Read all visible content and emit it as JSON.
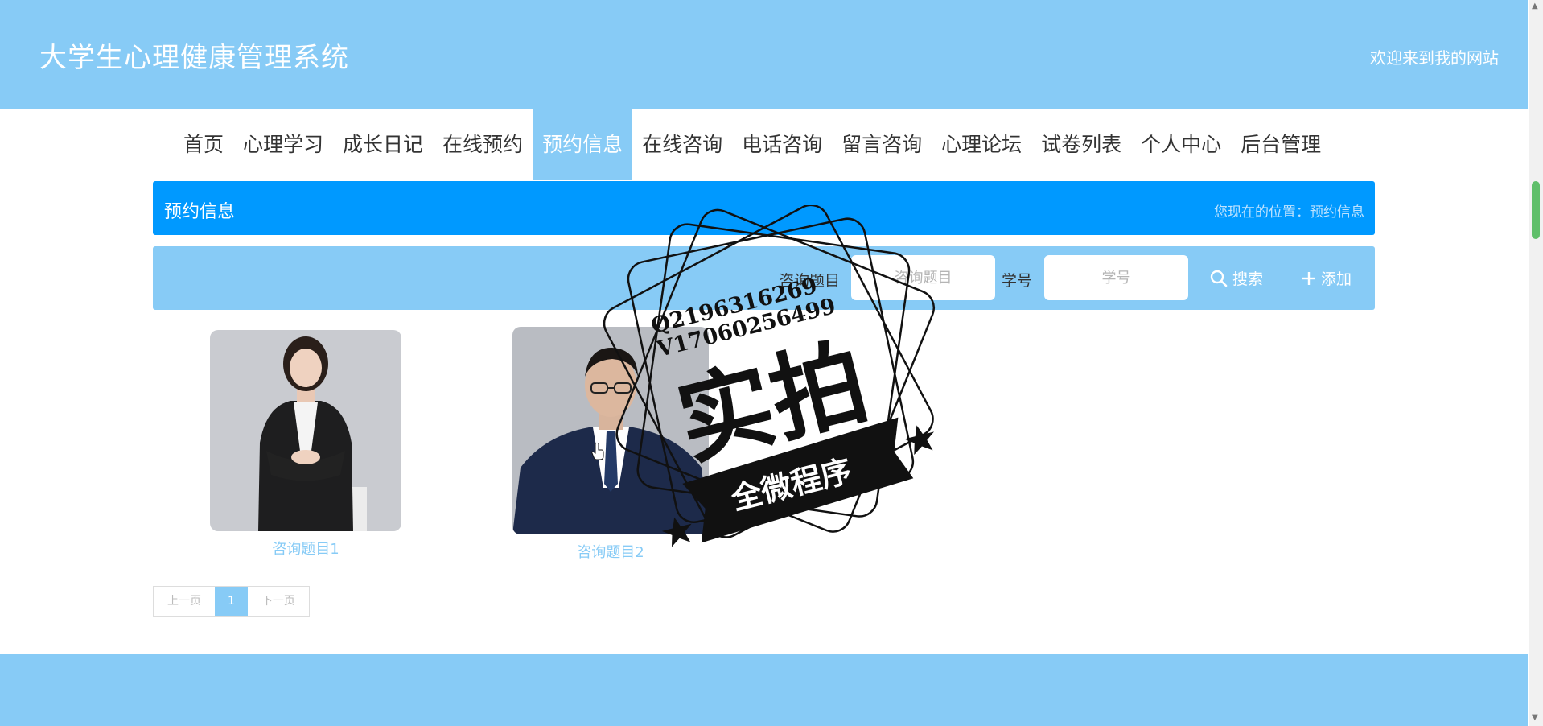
{
  "header": {
    "title": "大学生心理健康管理系统",
    "welcome": "欢迎来到我的网站"
  },
  "nav": {
    "items": [
      "首页",
      "心理学习",
      "成长日记",
      "在线预约",
      "预约信息",
      "在线咨询",
      "电话咨询",
      "留言咨询",
      "心理论坛",
      "试卷列表",
      "个人中心",
      "后台管理"
    ],
    "active": "预约信息"
  },
  "page": {
    "title": "预约信息",
    "breadcrumb": "您现在的位置：预约信息"
  },
  "search": {
    "topic_label": "咨询题目",
    "topic_placeholder": "咨询题目",
    "student_label": "学号",
    "student_placeholder": "学号",
    "search_button": "搜索",
    "add_button": "添加"
  },
  "cards": [
    {
      "label": "咨询题目1"
    },
    {
      "label": "咨询题目2"
    }
  ],
  "pagination": {
    "prev": "上一页",
    "current": "1",
    "next": "下一页"
  },
  "watermark": {
    "line1": "Q2196316269",
    "line2": "V17060256499",
    "main": "实拍",
    "banner": "全微程序"
  },
  "colors": {
    "header": "#87cbf6",
    "title_bar": "#0099ff",
    "card_label": "#87cbf6"
  }
}
